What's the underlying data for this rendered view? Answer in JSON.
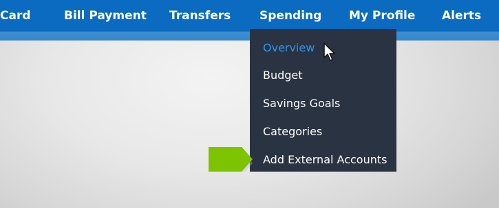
{
  "nav": {
    "items": [
      {
        "label": "Card"
      },
      {
        "label": "Bill Payment"
      },
      {
        "label": "Transfers"
      },
      {
        "label": "Spending"
      },
      {
        "label": "My Profile"
      },
      {
        "label": "Alerts"
      }
    ],
    "background_color": "#0a6bc0"
  },
  "spending_menu": {
    "items": [
      {
        "label": "Overview",
        "active": true
      },
      {
        "label": "Budget"
      },
      {
        "label": "Savings Goals"
      },
      {
        "label": "Categories"
      },
      {
        "label": "Add External Accounts"
      }
    ],
    "background_color": "#2a3341",
    "active_color": "#2f93e6"
  },
  "callout": {
    "icon": "green-arrow-icon",
    "color": "#7dc400"
  },
  "cursor": {
    "icon": "mouse-pointer-icon"
  }
}
